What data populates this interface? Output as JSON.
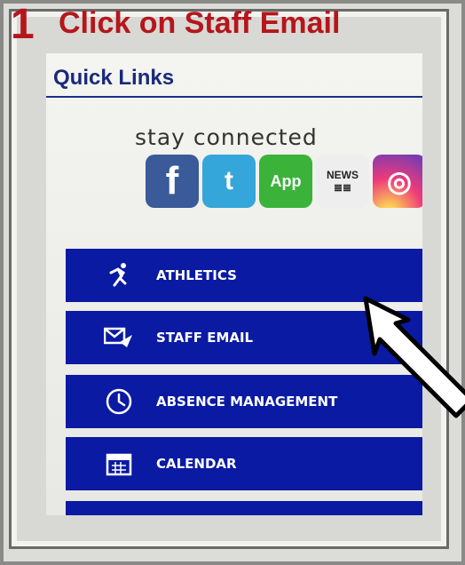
{
  "instruction": {
    "step_number": "1",
    "text": "Click on Staff Email"
  },
  "quick_links": {
    "title": "Quick Links",
    "stay_connected": "stay connected"
  },
  "social": {
    "facebook": "f",
    "twitter": "t",
    "app": "App",
    "news": "NEWS",
    "instagram": "◎"
  },
  "menu": {
    "items": [
      {
        "label": "ATHLETICS",
        "icon": "running-person-icon"
      },
      {
        "label": "STAFF EMAIL",
        "icon": "email-send-icon"
      },
      {
        "label": "ABSENCE MANAGEMENT",
        "icon": "clock-icon"
      },
      {
        "label": "CALENDAR",
        "icon": "calendar-icon"
      }
    ]
  },
  "colors": {
    "accent_red": "#b5161b",
    "menu_blue": "#0a1aa3"
  }
}
